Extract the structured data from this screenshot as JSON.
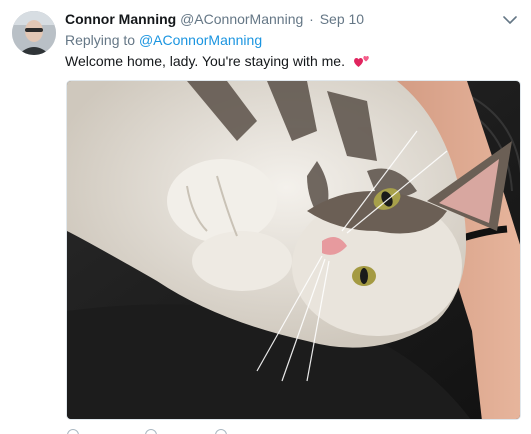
{
  "tweet": {
    "author_name": "Connor Manning",
    "author_handle": "@AConnorManning",
    "separator": "·",
    "timestamp": "Sep 10",
    "reply_prefix": "Replying to",
    "reply_handle": "@AConnorManning",
    "text": "Welcome home, lady. You're staying with me.",
    "emoji": "two-hearts-emoji",
    "menu_icon": "chevron-down-icon",
    "media_description_icon": "photo"
  },
  "colors": {
    "name": "#14171a",
    "meta": "#657786",
    "link": "#1b95e0",
    "heart": "#e0245e"
  }
}
